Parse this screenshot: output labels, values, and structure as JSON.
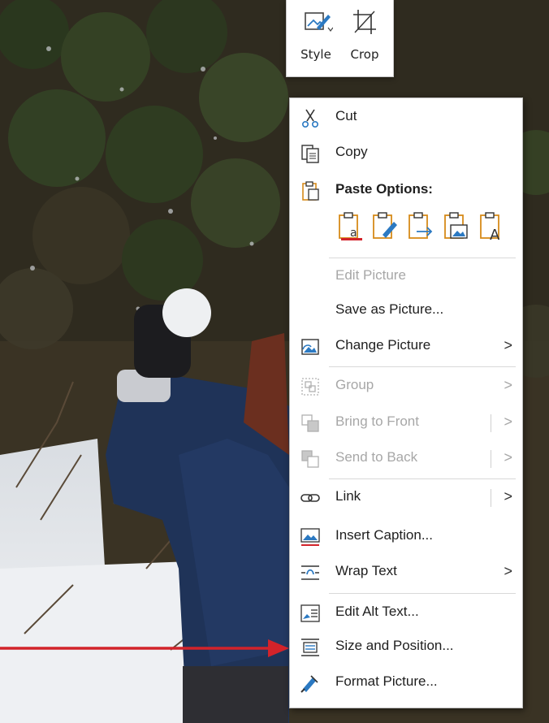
{
  "mini_toolbar": {
    "style_label": "Style",
    "crop_label": "Crop"
  },
  "menu": {
    "cut": "Cut",
    "copy": "Copy",
    "paste_options": "Paste Options:",
    "edit_picture": "Edit Picture",
    "save_as_picture": "Save as Picture...",
    "change_picture": "Change Picture",
    "group": "Group",
    "bring_to_front": "Bring to Front",
    "send_to_back": "Send to Back",
    "link": "Link",
    "insert_caption": "Insert Caption...",
    "wrap_text": "Wrap Text",
    "edit_alt_text": "Edit Alt Text...",
    "size_and_position": "Size and Position...",
    "format_picture": "Format Picture...",
    "submenu_arrow": ">"
  },
  "paste_option_icons": [
    "paste-keep-source-icon",
    "paste-merge-format-icon",
    "paste-link-icon",
    "paste-picture-icon",
    "paste-text-only-icon"
  ],
  "colors": {
    "arrow": "#d2232a",
    "icon_blue": "#2b79c2",
    "icon_orange": "#d68a1a",
    "menu_bg": "#ffffff",
    "disabled_text": "#a7a7a7"
  }
}
